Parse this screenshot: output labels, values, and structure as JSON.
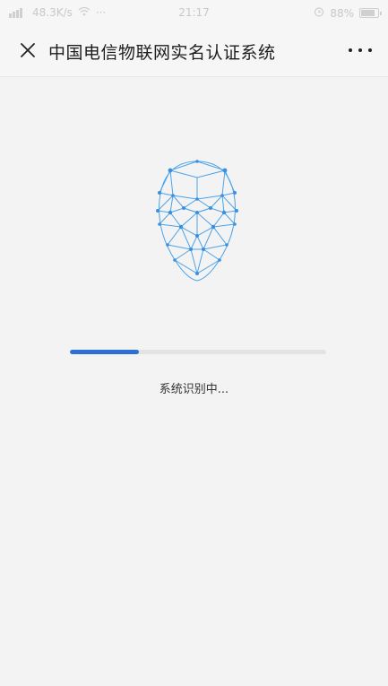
{
  "status_bar": {
    "carrier_icons": "信号",
    "speed": "48.3K/s",
    "more": "···",
    "time": "21:17",
    "battery_percent": "88%",
    "battery_level": 0.88
  },
  "nav": {
    "title": "中国电信物联网实名认证系统"
  },
  "recognition": {
    "progress": 0.27,
    "status_text": "系统识别中..."
  },
  "colors": {
    "accent": "#2d6fd4",
    "face_line": "#3d9be6",
    "background": "#f3f3f3"
  },
  "icons": {
    "close": "close-icon",
    "more": "more-icon",
    "face": "face-scan-icon"
  }
}
